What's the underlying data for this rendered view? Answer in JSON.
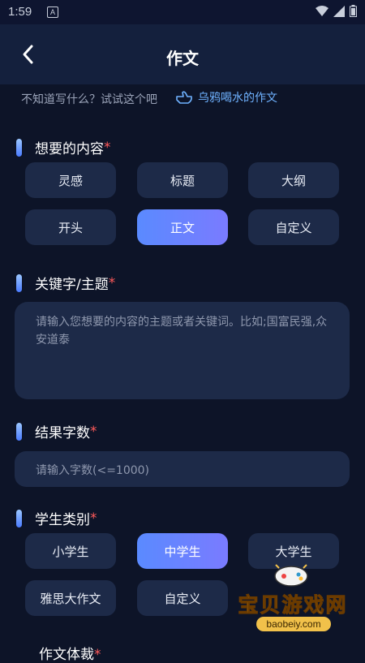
{
  "status": {
    "time": "1:59"
  },
  "header": {
    "title": "作文"
  },
  "hint": {
    "text": "不知道写什么？试试这个吧",
    "link_label": "乌鸦喝水的作文"
  },
  "sections": {
    "content": {
      "label": "想要的内容",
      "required": "*",
      "options": [
        "灵感",
        "标题",
        "大纲",
        "开头",
        "正文",
        "自定义"
      ],
      "selected": "正文"
    },
    "keywords": {
      "label": "关键字/主题",
      "required": "*",
      "placeholder": "请输入您想要的内容的主题或者关键词。比如;国富民强,众安道泰"
    },
    "wordcount": {
      "label": "结果字数",
      "required": "*",
      "placeholder": "请输入字数(<=1000)"
    },
    "student": {
      "label": "学生类别",
      "required": "*",
      "options": [
        "小学生",
        "中学生",
        "大学生",
        "雅思大作文",
        "自定义"
      ],
      "selected": "中学生"
    },
    "next": {
      "label": "作文体裁",
      "required": "*"
    }
  },
  "watermark": {
    "text": "宝贝游戏网",
    "url": "baobeiy.com"
  },
  "colors": {
    "background": "#0d1428",
    "surface": "#1d2a48",
    "accent": "#5a8aff",
    "required": "#ff5a5a",
    "link": "#6fb2ff"
  }
}
